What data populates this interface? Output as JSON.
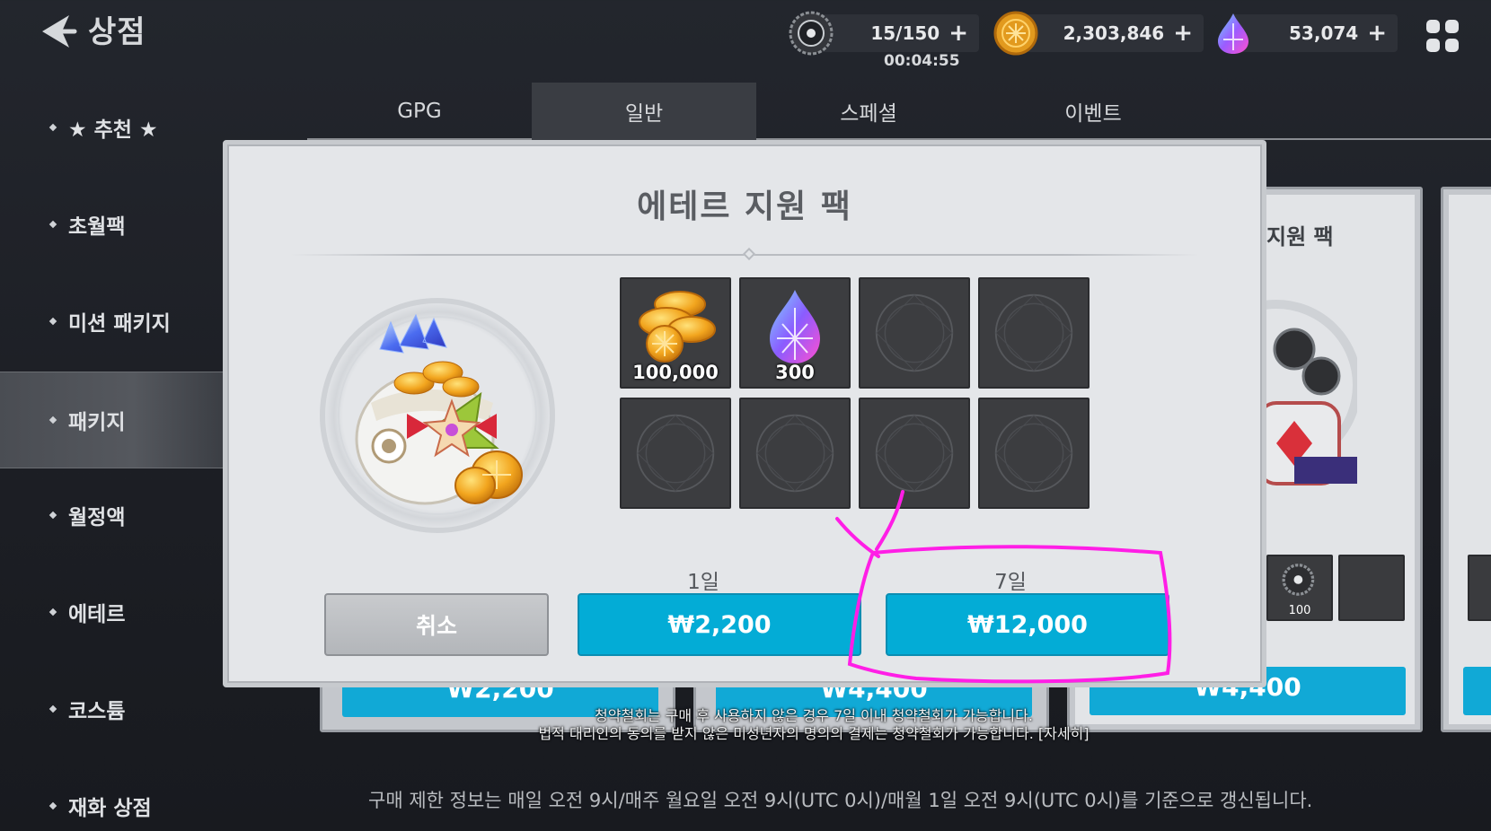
{
  "header": {
    "title": "상점",
    "resources": [
      {
        "icon": "stamina-gear-icon",
        "amount": "15/150",
        "plus": "+"
      },
      {
        "icon": "gold-coin-icon",
        "amount": "2,303,846",
        "plus": "+"
      },
      {
        "icon": "aether-crystal-icon",
        "amount": "53,074",
        "plus": "+"
      }
    ],
    "timer": "00:04:55"
  },
  "sidebar": {
    "items": [
      {
        "label": "★ 추천 ★"
      },
      {
        "label": "초월팩"
      },
      {
        "label": "미션 패키지"
      },
      {
        "label": "패키지",
        "active": true
      },
      {
        "label": "월정액"
      },
      {
        "label": "에테르"
      },
      {
        "label": "코스튬"
      },
      {
        "label": "재화 상점"
      }
    ]
  },
  "tabs": [
    {
      "label": "GPG"
    },
    {
      "label": "일반",
      "active": true
    },
    {
      "label": "스페셜"
    },
    {
      "label": "이벤트"
    }
  ],
  "background": {
    "card_title_partial": "지원 팩",
    "prices": [
      "₩2,200",
      "₩4,400",
      "₩4,400"
    ],
    "slot_qty": "100"
  },
  "modal": {
    "title": "에테르 지원 팩",
    "rewards": [
      {
        "icon": "gold-coins-icon",
        "qty": "100,000"
      },
      {
        "icon": "aether-crystal-icon",
        "qty": "300"
      }
    ],
    "options": [
      {
        "days": "1일",
        "price": "₩2,200"
      },
      {
        "days": "7일",
        "price": "₩12,000"
      }
    ],
    "cancel_label": "취소"
  },
  "notices": {
    "line1": "청약철회는 구매 후 사용하지 않은 경우 7일 이내 청약철회가 가능합니다.",
    "line2": "법적 대리인의 동의를 받지 않은 미성년자의 명의의 결제는 청약철회가 가능합니다. [자세히]",
    "footer": "구매 제한 정보는 매일 오전 9시/매주 월요일 오전 9시(UTC 0시)/매월 1일 오전 9시(UTC 0시)를 기준으로 갱신됩니다."
  },
  "colors": {
    "buy_button": "#03acd6",
    "annotation": "#ff1ee6"
  }
}
